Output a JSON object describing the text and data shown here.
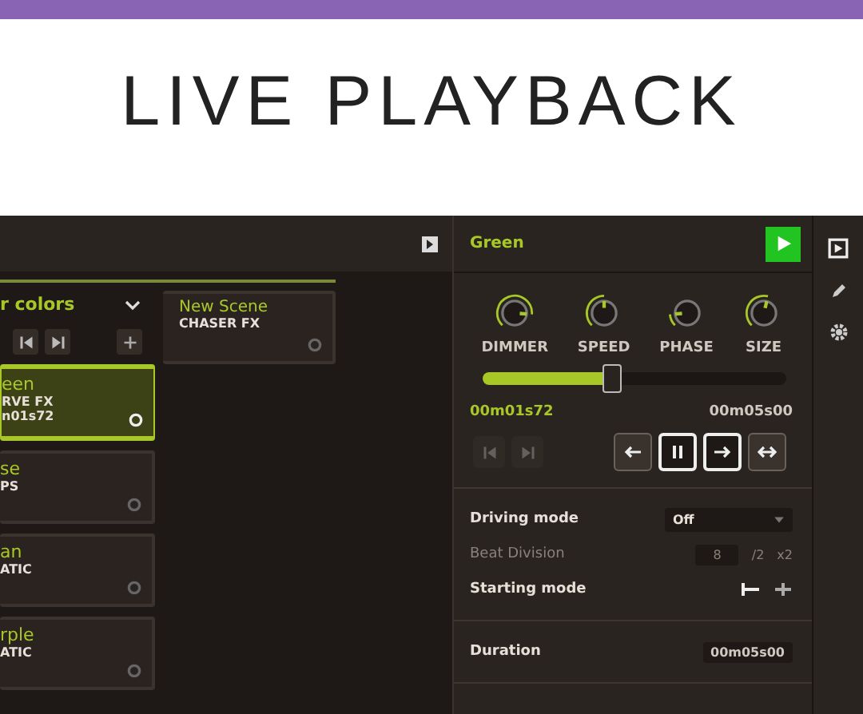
{
  "heading": "LIVE PLAYBACK",
  "collection": {
    "title": "r colors",
    "cards": [
      {
        "title": "een",
        "type": "RVE FX",
        "time": "n01s72",
        "selected": true
      },
      {
        "title": "se",
        "type": "PS",
        "selected": false
      },
      {
        "title": "an",
        "type": "ATIC",
        "selected": false
      },
      {
        "title": "rple",
        "type": "ATIC",
        "selected": false
      }
    ]
  },
  "scene_card": {
    "title": "New Scene",
    "type": "CHASER FX"
  },
  "panel": {
    "title": "Green",
    "knobs": [
      {
        "label": "DIMMER"
      },
      {
        "label": "SPEED"
      },
      {
        "label": "PHASE"
      },
      {
        "label": "SIZE"
      }
    ],
    "progress": {
      "level": 0.42
    },
    "elapsed": "00m01s72",
    "total": "00m05s00",
    "transport": [
      {
        "kind": "prev",
        "disabled": true,
        "selected": false
      },
      {
        "kind": "next",
        "disabled": true,
        "selected": false
      },
      {
        "kind": "backward",
        "disabled": false,
        "selected": false
      },
      {
        "kind": "pause",
        "disabled": false,
        "selected": true
      },
      {
        "kind": "forward",
        "disabled": false,
        "selected": true
      },
      {
        "kind": "bounce",
        "disabled": false,
        "selected": false
      }
    ],
    "driving_mode": {
      "label": "Driving mode",
      "value": "Off"
    },
    "beat_division": {
      "label": "Beat Division",
      "value": "8",
      "divide": "/2",
      "multiply": "x2",
      "disabled": true
    },
    "starting_mode": {
      "label": "Starting mode"
    },
    "duration": {
      "label": "Duration",
      "value": "00m05s00"
    }
  }
}
